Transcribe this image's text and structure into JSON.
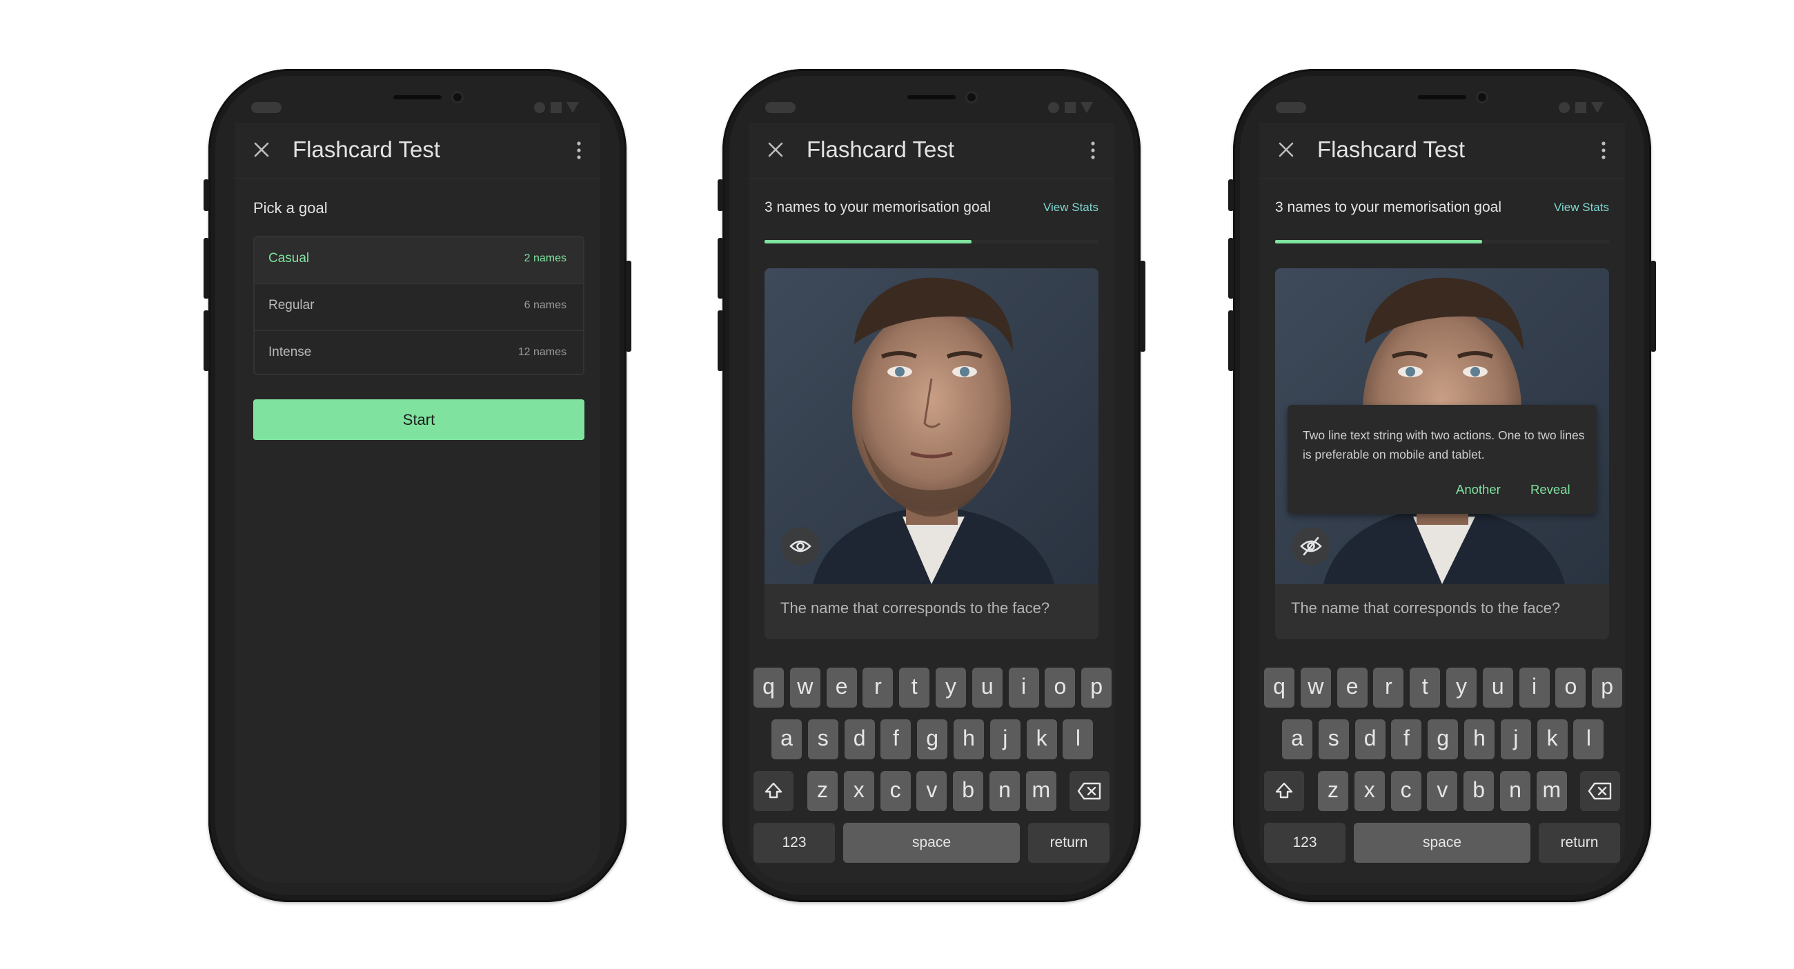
{
  "app": {
    "title": "Flashcard Test"
  },
  "screen1": {
    "prompt": "Pick a goal",
    "goals": [
      {
        "label": "Casual",
        "count": "2 names",
        "selected": true
      },
      {
        "label": "Regular",
        "count": "6 names",
        "selected": false
      },
      {
        "label": "Intense",
        "count": "12 names",
        "selected": false
      }
    ],
    "start_label": "Start"
  },
  "screen2": {
    "goal_text": "3 names to your memorisation goal",
    "view_stats": "View Stats",
    "progress": 0.62,
    "question": "The name that corresponds to the face?",
    "eye_icon": "eye-icon"
  },
  "screen3": {
    "goal_text": "3 names to your memorisation goal",
    "view_stats": "View Stats",
    "progress": 0.62,
    "question": "The name that corresponds to the face?",
    "eye_icon": "eye-off-icon",
    "snackbar": {
      "text": "Two line text string with two actions. One to two lines is preferable on mobile and tablet.",
      "action_another": "Another",
      "action_reveal": "Reveal"
    }
  },
  "keyboard": {
    "row1": [
      "q",
      "w",
      "e",
      "r",
      "t",
      "y",
      "u",
      "i",
      "o",
      "p"
    ],
    "row2": [
      "a",
      "s",
      "d",
      "f",
      "g",
      "h",
      "j",
      "k",
      "l"
    ],
    "row3": [
      "z",
      "x",
      "c",
      "v",
      "b",
      "n",
      "m"
    ],
    "numbers": "123",
    "space": "space",
    "return": "return"
  },
  "colors": {
    "accent": "#7fe39f",
    "link": "#7fd6d0",
    "surface": "#262626"
  }
}
